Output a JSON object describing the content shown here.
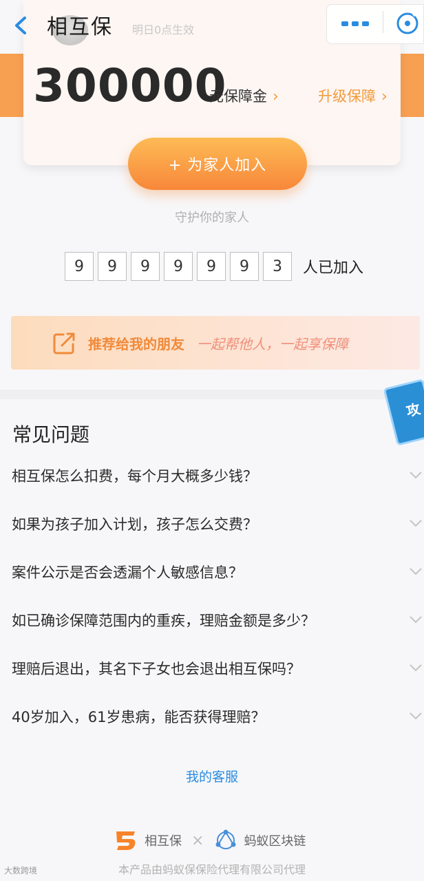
{
  "header": {
    "title": "相互保",
    "background_text": "明日0点生效"
  },
  "summary": {
    "amount": "300000",
    "amount_unit": "元保障金",
    "upgrade_label": "升级保障",
    "chevron": "›",
    "add_family_label": "+ 为家人加入",
    "tagline": "守护你的家人"
  },
  "counter": {
    "digits": [
      "9",
      "9",
      "9",
      "9",
      "9",
      "9",
      "3"
    ],
    "suffix": "人已加入"
  },
  "recommend": {
    "title": "推荐给我的朋友",
    "slogan": "一起帮他人，一起享保障"
  },
  "strategy_badge": {
    "label": "攻"
  },
  "faq": {
    "title": "常见问题",
    "items": [
      "相互保怎么扣费，每个月大概多少钱？",
      "如果为孩子加入计划，孩子怎么交费？",
      "案件公示是否会透漏个人敏感信息？",
      "如已确诊保障范围内的重疾，理赔金额是多少？",
      "理赔后退出，其名下子女也会退出相互保吗？",
      "40岁加入，61岁患病，能否获得理赔？"
    ]
  },
  "footer": {
    "service_link": "我的客服",
    "brand1": "相互保",
    "times": "×",
    "brand2": "蚂蚁区块链",
    "note": "本产品由蚂蚁保保险代理有限公司代理",
    "watermark": "大数跨境"
  },
  "colors": {
    "accent": "#f39a3a",
    "link": "#2a8ce0",
    "orange_band": "#f8a052"
  },
  "icons": [
    "back-arrow-icon",
    "more-icon",
    "close-icon",
    "share-icon",
    "chevron-down-icon",
    "xianghubao-logo-icon",
    "ant-blockchain-logo-icon"
  ]
}
